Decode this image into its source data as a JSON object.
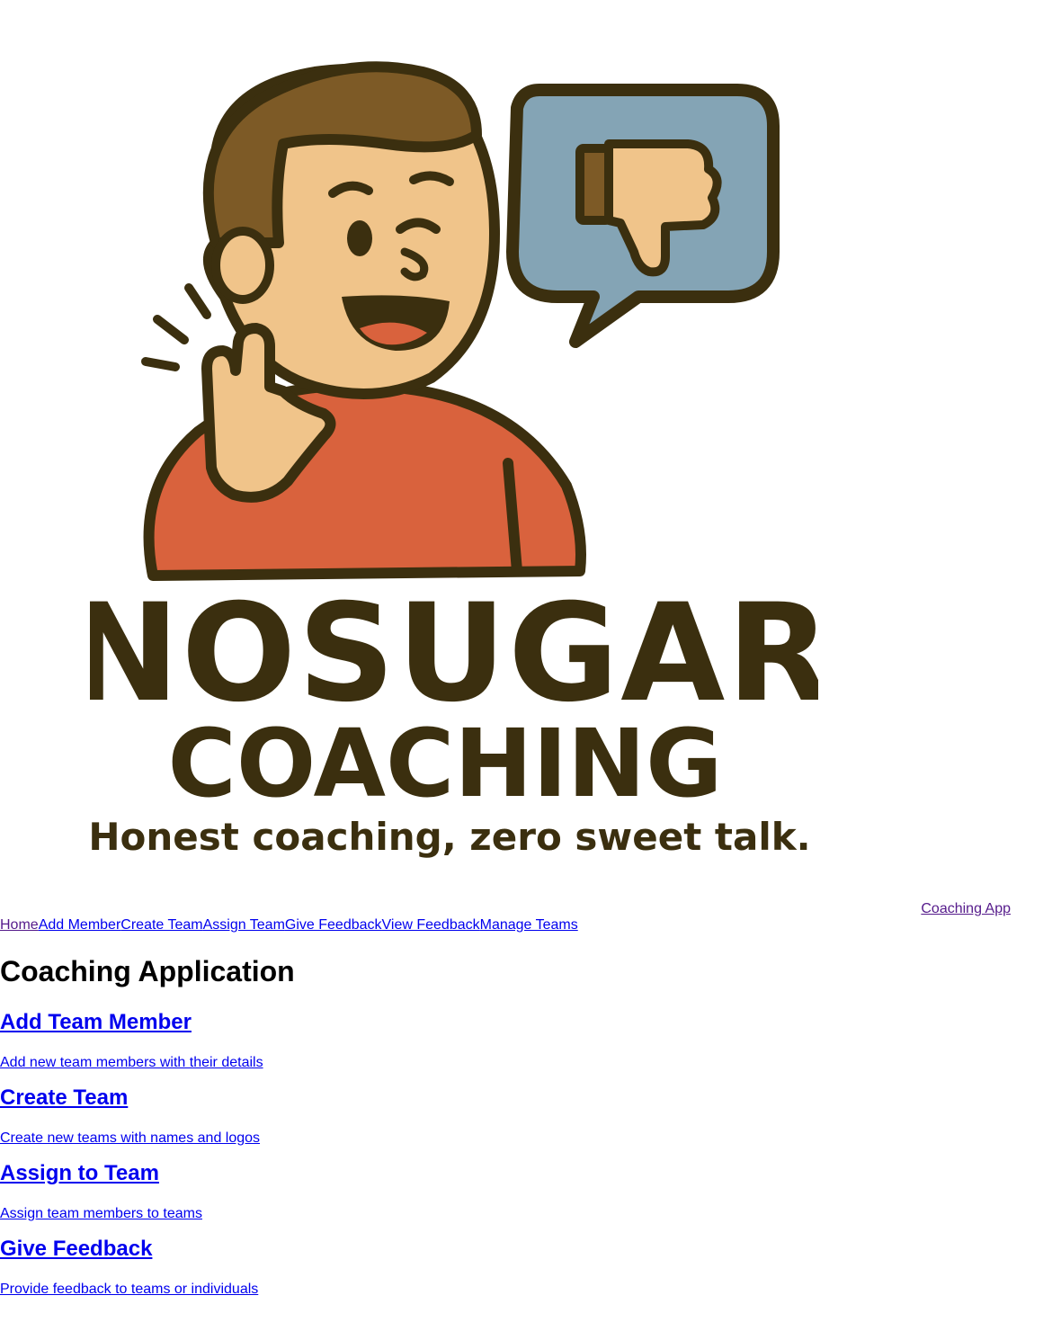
{
  "logo": {
    "title_line1": "NOSUGAR",
    "title_line2": "COACHING",
    "tagline": "Honest coaching, zero sweet talk.",
    "icons": [
      "waving-person-icon",
      "thumbs-down-icon",
      "speech-bubble-icon"
    ],
    "colors": {
      "outline": "#3b2f0f",
      "hair": "#7d5a26",
      "skin": "#f0c48a",
      "shirt": "#d9623d",
      "bubble": "#84a4b5"
    }
  },
  "brand_link": "Coaching App",
  "nav": {
    "items": [
      "Home",
      "Add Member",
      "Create Team",
      "Assign Team",
      "Give Feedback",
      "View Feedback",
      "Manage Teams"
    ]
  },
  "main": {
    "title": "Coaching Application",
    "cards": [
      {
        "title": "Add Team Member",
        "description": "Add new team members with their details"
      },
      {
        "title": "Create Team",
        "description": "Create new teams with names and logos"
      },
      {
        "title": "Assign to Team",
        "description": "Assign team members to teams"
      },
      {
        "title": "Give Feedback",
        "description": "Provide feedback to teams or individuals"
      }
    ]
  },
  "colors": {
    "link": "#0000ee",
    "visited": "#551a8b",
    "text": "#000000",
    "background": "#ffffff"
  }
}
